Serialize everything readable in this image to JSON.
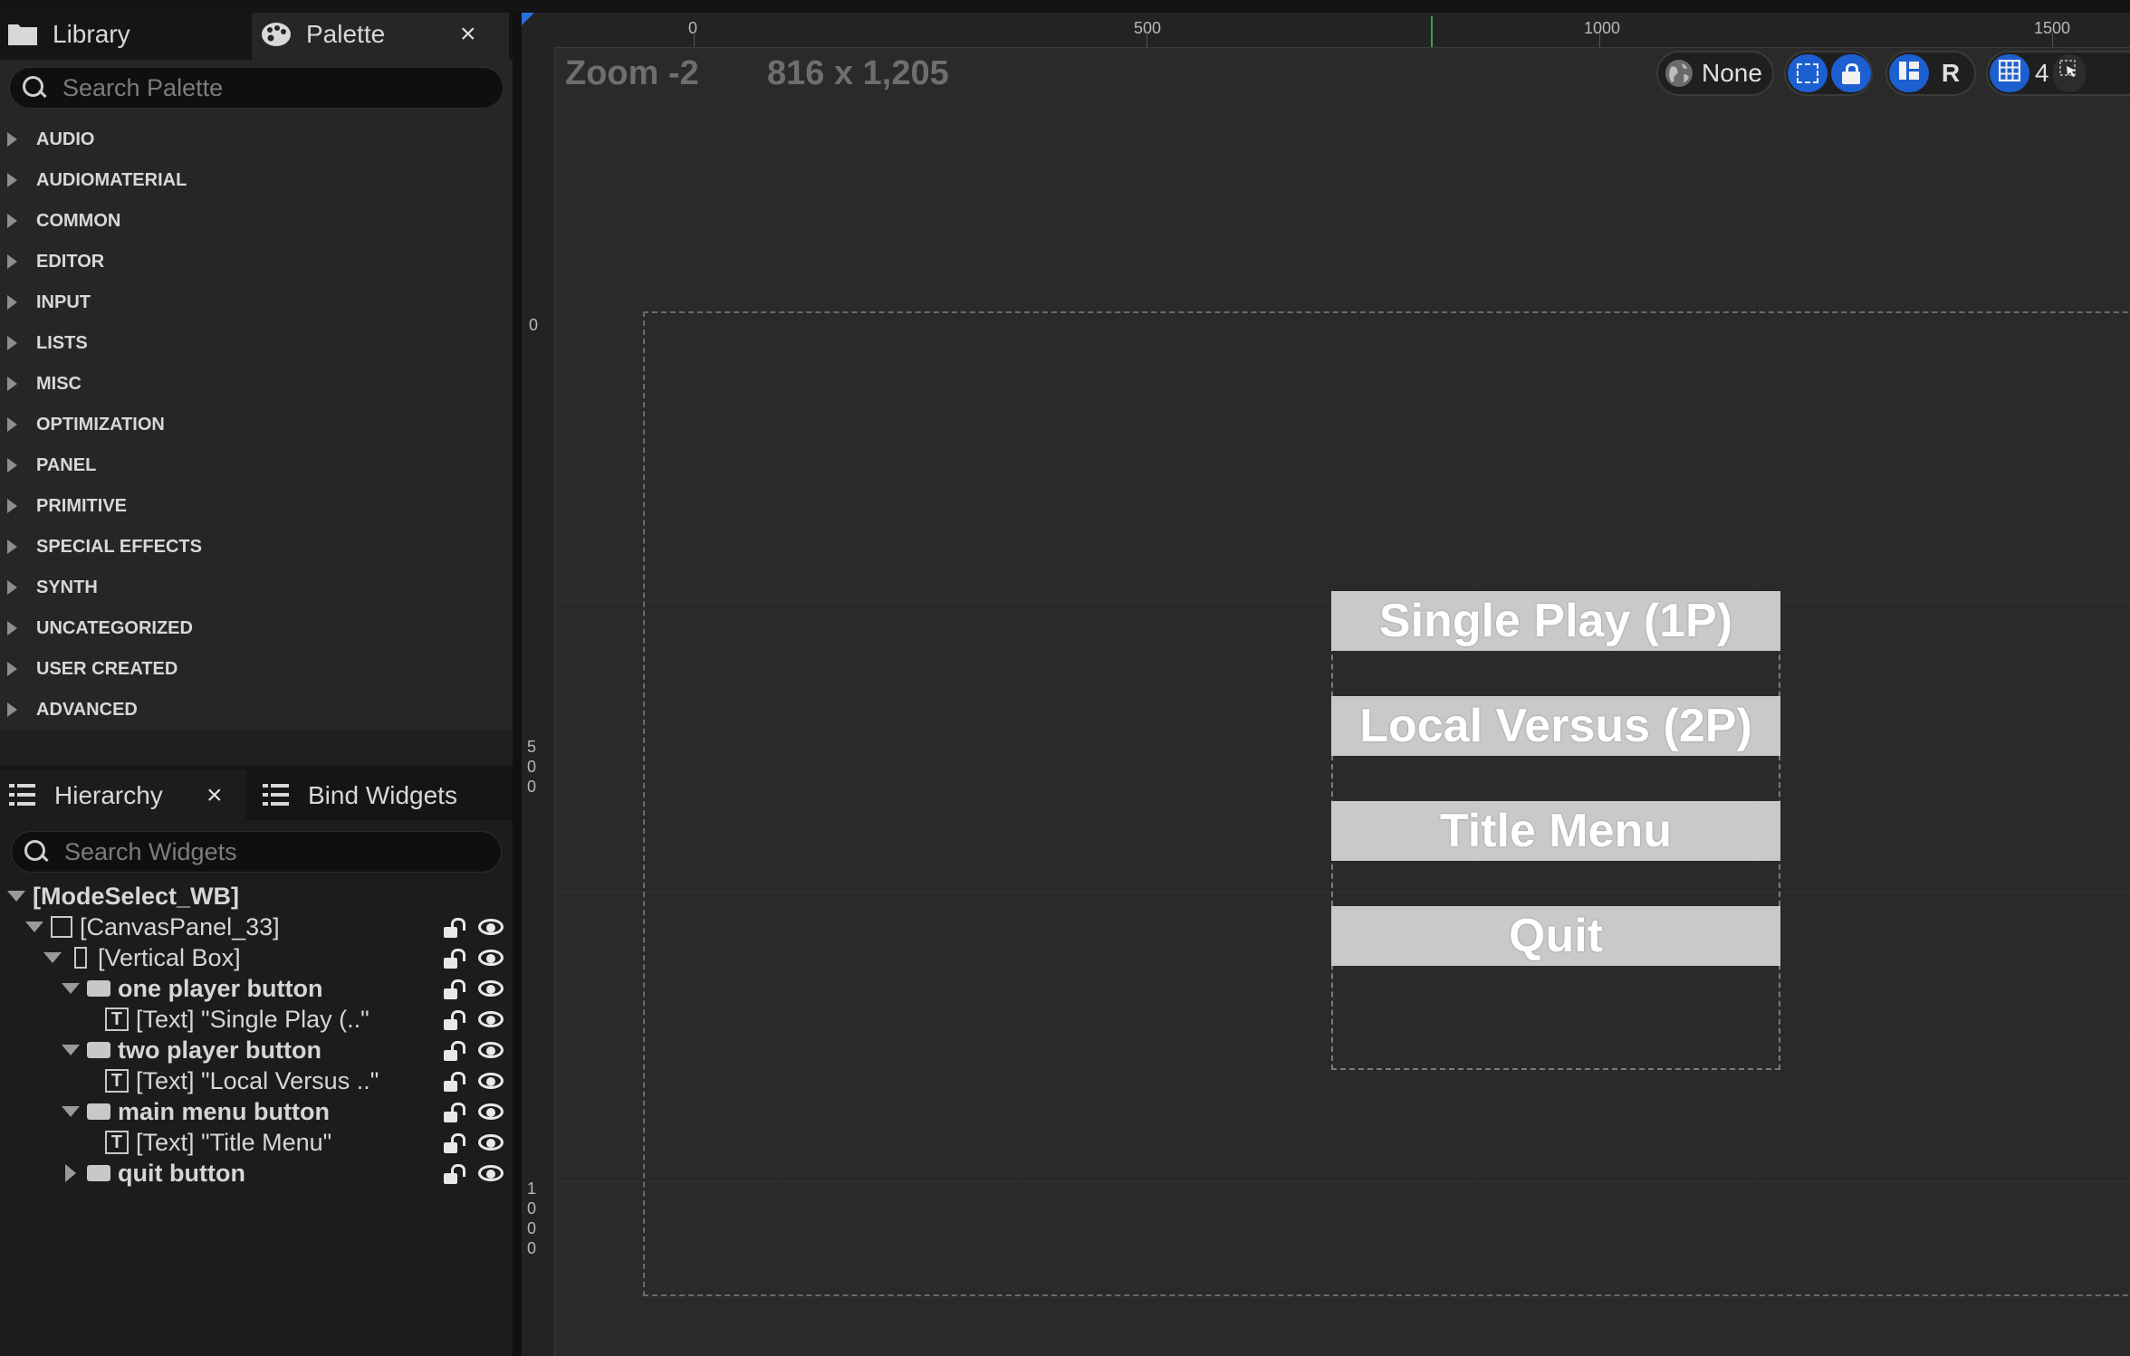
{
  "tabs_top": {
    "library": "Library",
    "palette": "Palette",
    "close": "×"
  },
  "palette_search": {
    "placeholder": "Search Palette"
  },
  "palette_categories": [
    "AUDIO",
    "AUDIOMATERIAL",
    "COMMON",
    "EDITOR",
    "INPUT",
    "LISTS",
    "MISC",
    "OPTIMIZATION",
    "PANEL",
    "PRIMITIVE",
    "SPECIAL EFFECTS",
    "SYNTH",
    "UNCATEGORIZED",
    "USER CREATED",
    "ADVANCED"
  ],
  "tabs_bottom": {
    "hierarchy": "Hierarchy",
    "bind_widgets": "Bind Widgets",
    "close": "×"
  },
  "widget_search": {
    "placeholder": "Search Widgets"
  },
  "hierarchy": [
    {
      "label": "[ModeSelect_WB]",
      "depth": 0,
      "expanded": true,
      "icon": "none",
      "bold": true
    },
    {
      "label": "[CanvasPanel_33]",
      "depth": 1,
      "expanded": true,
      "icon": "canvas-panel-icon",
      "bold": false
    },
    {
      "label": "[Vertical Box]",
      "depth": 2,
      "expanded": true,
      "icon": "vertical-box-icon",
      "bold": false
    },
    {
      "label": "one player button",
      "depth": 3,
      "expanded": true,
      "icon": "button-icon",
      "bold": true
    },
    {
      "label": "[Text] \"Single Play (..\"",
      "depth": 4,
      "expanded": null,
      "icon": "text-icon",
      "bold": false
    },
    {
      "label": "two player button",
      "depth": 3,
      "expanded": true,
      "icon": "button-icon",
      "bold": true
    },
    {
      "label": "[Text] \"Local Versus ..\"",
      "depth": 4,
      "expanded": null,
      "icon": "text-icon",
      "bold": false
    },
    {
      "label": "main menu button",
      "depth": 3,
      "expanded": true,
      "icon": "button-icon",
      "bold": true
    },
    {
      "label": "[Text] \"Title Menu\"",
      "depth": 4,
      "expanded": null,
      "icon": "text-icon",
      "bold": false
    },
    {
      "label": "quit button",
      "depth": 3,
      "expanded": false,
      "icon": "button-icon",
      "bold": true
    }
  ],
  "designer": {
    "zoom": "Zoom -2",
    "resolution": "816 x 1,205",
    "ruler_top_labels": [
      "0",
      "500",
      "1000",
      "1500"
    ],
    "ruler_left_labels": [
      "0",
      "500",
      "1000"
    ],
    "toolbar": {
      "localization": "None",
      "r_label": "R",
      "grid_value": "4"
    },
    "buttons": [
      "Single Play (1P)",
      "Local Versus (2P)",
      "Title Menu",
      "Quit"
    ]
  },
  "colors": {
    "accent_blue": "#1c5fd0",
    "button_fill": "#c9c9c9",
    "canvas_bg": "#2a2a2a"
  }
}
